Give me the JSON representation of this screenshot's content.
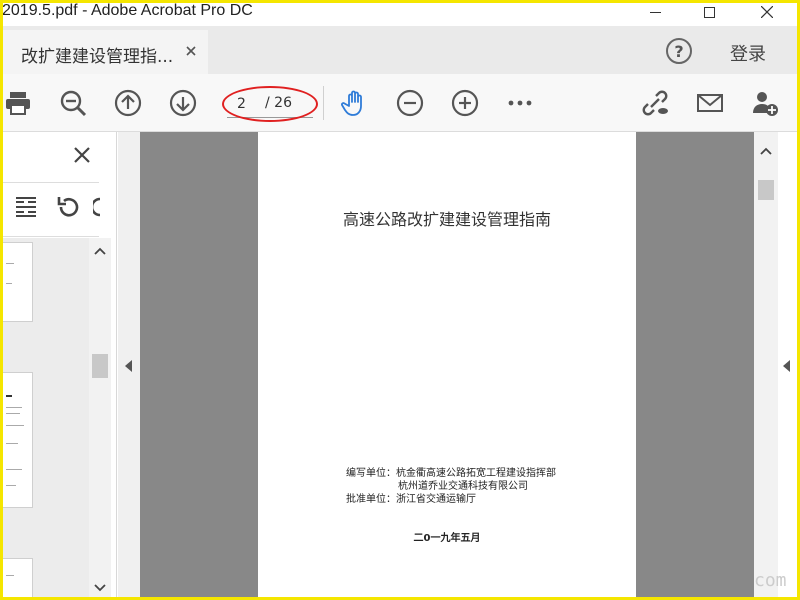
{
  "window": {
    "title": "2019.5.pdf - Adobe Acrobat Pro DC"
  },
  "tab": {
    "label": "改扩建建设管理指..."
  },
  "header": {
    "help_glyph": "?",
    "login_label": "登录"
  },
  "toolbar": {
    "current_page": "2",
    "total_pages": "/ 26",
    "icons": [
      "print-icon",
      "zoom-out-search-icon",
      "page-up-icon",
      "page-down-icon",
      "hand-tool-icon",
      "zoom-out-icon",
      "zoom-in-icon",
      "more-icon",
      "share-link-icon",
      "email-icon",
      "add-user-icon"
    ]
  },
  "accent_color": "#2f7cd8",
  "highlight_color": "#e02020",
  "document": {
    "title": "高速公路改扩建建设管理指南",
    "compiled_by_label": "编写单位：",
    "compiled_by_1": "杭金衢高速公路拓宽工程建设指挥部",
    "compiled_by_2": "杭州道乔业交通科技有限公司",
    "approved_by_label": "批准单位：",
    "approved_by": "浙江省交通运输厅",
    "date": "二0一九年五月"
  },
  "watermark": "com"
}
